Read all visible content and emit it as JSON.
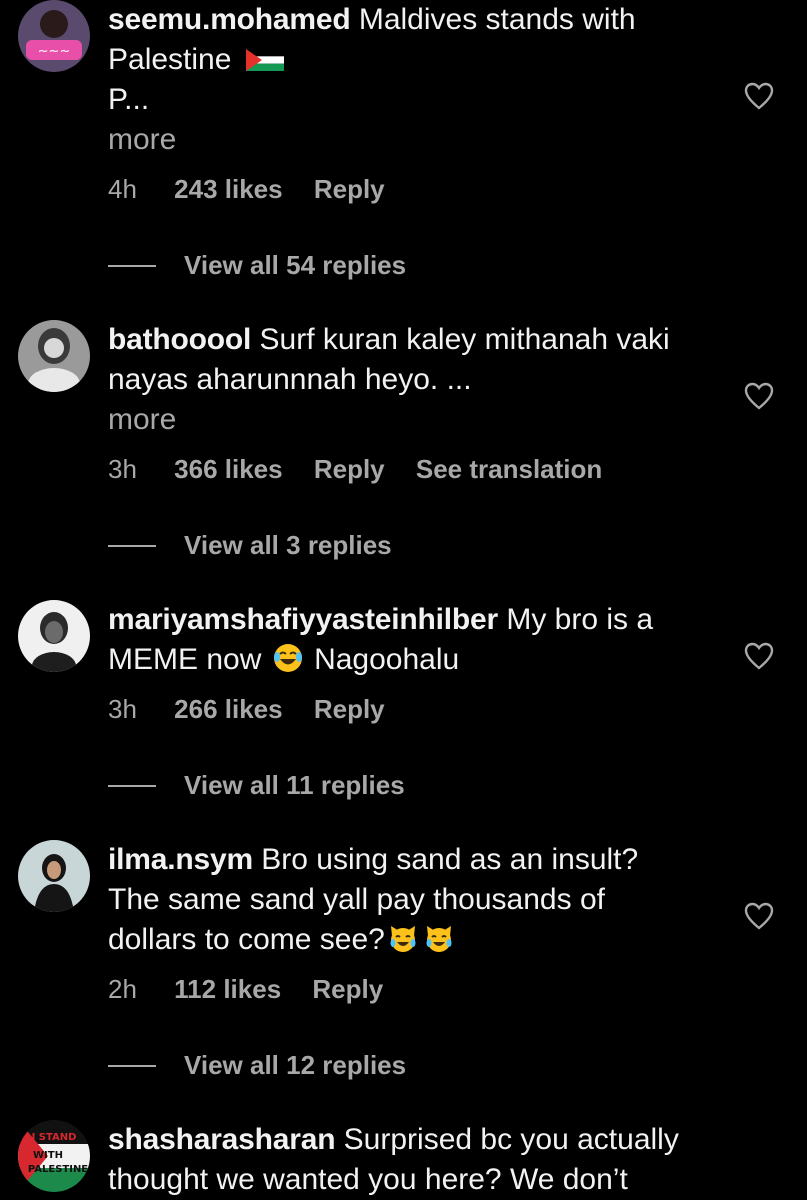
{
  "comments": [
    {
      "username": "seemu.mohamed",
      "text_lines": [
        "Maldives stands with",
        "Palestine",
        "P..."
      ],
      "more": "more",
      "time": "4h",
      "likes": "243 likes",
      "reply": "Reply",
      "view_replies": "View all 54 replies"
    },
    {
      "username": "bathooool",
      "text_lines": [
        "Surf kuran kaley mithanah vaki",
        "nayas aharunnnah heyo. ..."
      ],
      "more": "more",
      "time": "3h",
      "likes": "366 likes",
      "reply": "Reply",
      "see_translation": "See translation",
      "view_replies": "View all 3 replies"
    },
    {
      "username": "mariyamshafiyyasteinhilber",
      "text_lines": [
        "My bro is a",
        "MEME now",
        "Nagoohalu"
      ],
      "time": "3h",
      "likes": "266 likes",
      "reply": "Reply",
      "view_replies": "View all 11 replies"
    },
    {
      "username": "ilma.nsym",
      "text_lines": [
        "Bro using sand as an insult?",
        "The same sand yall pay thousands of",
        "dollars to come see?"
      ],
      "time": "2h",
      "likes": "112 likes",
      "reply": "Reply",
      "view_replies": "View all 12 replies"
    },
    {
      "username": "shasharasharan",
      "text_lines": [
        "Surprised bc you actually",
        "thought we wanted you here? We don’t"
      ],
      "avatar_text": [
        "I STAND",
        "WITH",
        "PALESTINE"
      ]
    }
  ],
  "icons": {
    "like": "heart-outline-icon",
    "flag": "palestine-flag-icon",
    "laugh_emoji": "face-with-tears-of-joy-emoji",
    "cat_emoji": "grinning-cat-with-smiling-eyes-emoji"
  },
  "colors": {
    "background": "#000000",
    "primary_text": "#f2f2f2",
    "secondary_text": "#a8a8a8"
  }
}
